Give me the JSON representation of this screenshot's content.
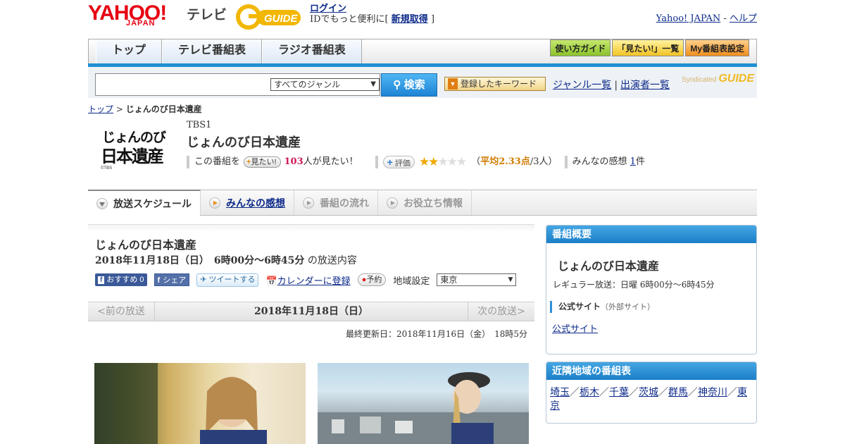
{
  "header": {
    "logo_main": "YAHOO!",
    "logo_sub": "JAPAN",
    "logo_tv": "テレビ",
    "gguide": "GUIDE",
    "login": "ログイン",
    "login_line2_prefix": "IDでもっと便利に[",
    "signup": "新規取得",
    "login_line2_suffix": "]",
    "yahoo_japan": "Yahoo! JAPAN",
    "dash": "-",
    "help": "ヘルプ"
  },
  "nav": {
    "tabs": [
      "トップ",
      "テレビ番組表",
      "ラジオ番組表"
    ],
    "right_buttons": [
      "使い方ガイド",
      "「見たい!」一覧",
      "My番組表設定"
    ]
  },
  "search": {
    "placeholder": "",
    "genre": "すべてのジャンル",
    "button": "検索",
    "keyword_button": "登録したキーワード",
    "genre_list": "ジャンル一覧",
    "sep": "|",
    "cast_list": "出演者一覧",
    "syndicated": "Syndicated"
  },
  "breadcrumb": {
    "top": "トップ",
    "sep": ">",
    "current": "じょんのび日本遺産"
  },
  "program": {
    "logo_line1": "じょんのび",
    "logo_line2": "日本遺産",
    "logo_tbs": "©TBS",
    "station": "TBS1",
    "title": "じょんのび日本遺産",
    "want_prefix": "この番組を",
    "want_button": "見たい!",
    "want_count": "103",
    "want_suffix": "人が見たい！",
    "rate_button": "評価",
    "rating_stars": 2.33,
    "avg_open": "（",
    "avg_label": "平均2.33点",
    "avg_close": "/3人）",
    "reviews_label": "みんなの感想",
    "reviews_count": "1",
    "reviews_suffix": "件"
  },
  "tabs": [
    {
      "label": "放送スケジュール"
    },
    {
      "label": "みんなの感想"
    },
    {
      "label": "番組の流れ"
    },
    {
      "label": "お役立ち情報"
    }
  ],
  "episode": {
    "title": "じょんのび日本遺産",
    "date_bold": "2018年11月18日（日）　6時00分～6時45分",
    "date_suffix": "の放送内容",
    "fb_recommend": "おすすめ",
    "fb_count": "0",
    "fb_share": "シェア",
    "tweet": "ツイートする",
    "calendar": "カレンダーに登録",
    "reserve": "予約",
    "region_label": "地域設定",
    "region_value": "東京",
    "prev": "<前の放送",
    "current_date": "2018年11月18日（日）",
    "next": "次の放送>",
    "updated": "最終更新日：2018年11月16日（金）　18時5分"
  },
  "sidebar": {
    "overview_head": "番組概要",
    "overview_title": "じょんのび日本遺産",
    "regular": "レギュラー放送：日曜 6時00分～6時45分",
    "official_head": "公式サイト",
    "official_note": "（外部サイト）",
    "official_link": "公式サイト",
    "nearby_head": "近隣地域の番組表",
    "nearby_regions": [
      "埼玉",
      "栃木",
      "千葉",
      "茨城",
      "群馬",
      "神奈川",
      "東京"
    ],
    "region_sep": "／"
  },
  "colors": {
    "brand_red": "#e60012",
    "nav_blue": "#1f8fd2",
    "link": "#0d2a8a",
    "star": "#f0a800"
  }
}
